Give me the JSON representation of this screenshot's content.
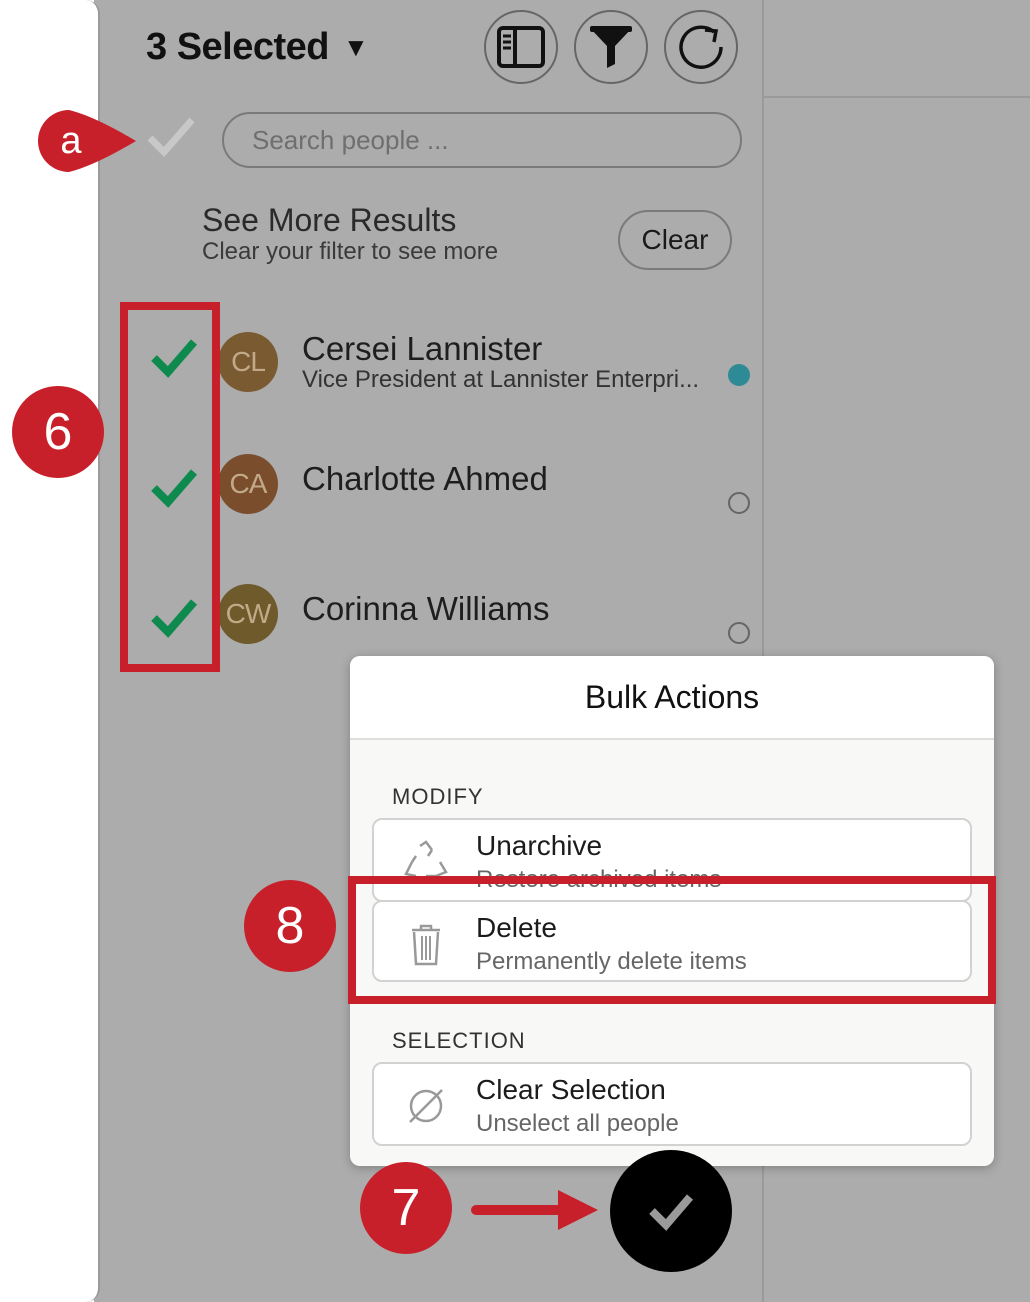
{
  "header": {
    "selected_label": "3 Selected",
    "caret": "▼",
    "buttons": [
      {
        "name": "columns-icon"
      },
      {
        "name": "filter-icon"
      },
      {
        "name": "refresh-icon"
      }
    ]
  },
  "search": {
    "placeholder": "Search people ..."
  },
  "see_more": {
    "title": "See More Results",
    "subtitle": "Clear your filter to see more",
    "clear_label": "Clear"
  },
  "people": [
    {
      "initials": "CL",
      "name": "Cersei Lannister",
      "subtitle": "Vice President at Lannister Enterpri...",
      "status": "online",
      "selected": true,
      "avatar_color": "#7a5a30"
    },
    {
      "initials": "CA",
      "name": "Charlotte Ahmed",
      "subtitle": "",
      "status": "offline",
      "selected": true,
      "avatar_color": "#7a4e2c"
    },
    {
      "initials": "CW",
      "name": "Corinna Williams",
      "subtitle": "",
      "status": "offline",
      "selected": true,
      "avatar_color": "#6e5a2a"
    }
  ],
  "bulk_actions": {
    "title": "Bulk Actions",
    "sections": [
      {
        "label": "Modify",
        "actions": [
          {
            "title": "Unarchive",
            "subtitle": "Restore archived items",
            "icon": "recycle-icon"
          },
          {
            "title": "Delete",
            "subtitle": "Permanently delete items",
            "icon": "trash-icon"
          }
        ]
      },
      {
        "label": "Selection",
        "actions": [
          {
            "title": "Clear Selection",
            "subtitle": "Unselect all people",
            "icon": "empty-set-icon"
          }
        ]
      }
    ]
  },
  "annotations": {
    "marker_a": "a",
    "marker_6": "6",
    "marker_7": "7",
    "marker_8": "8"
  },
  "colors": {
    "accent_red": "#c8202a",
    "check_green": "#0f8a4e",
    "overlay_gray": "#acacac"
  }
}
